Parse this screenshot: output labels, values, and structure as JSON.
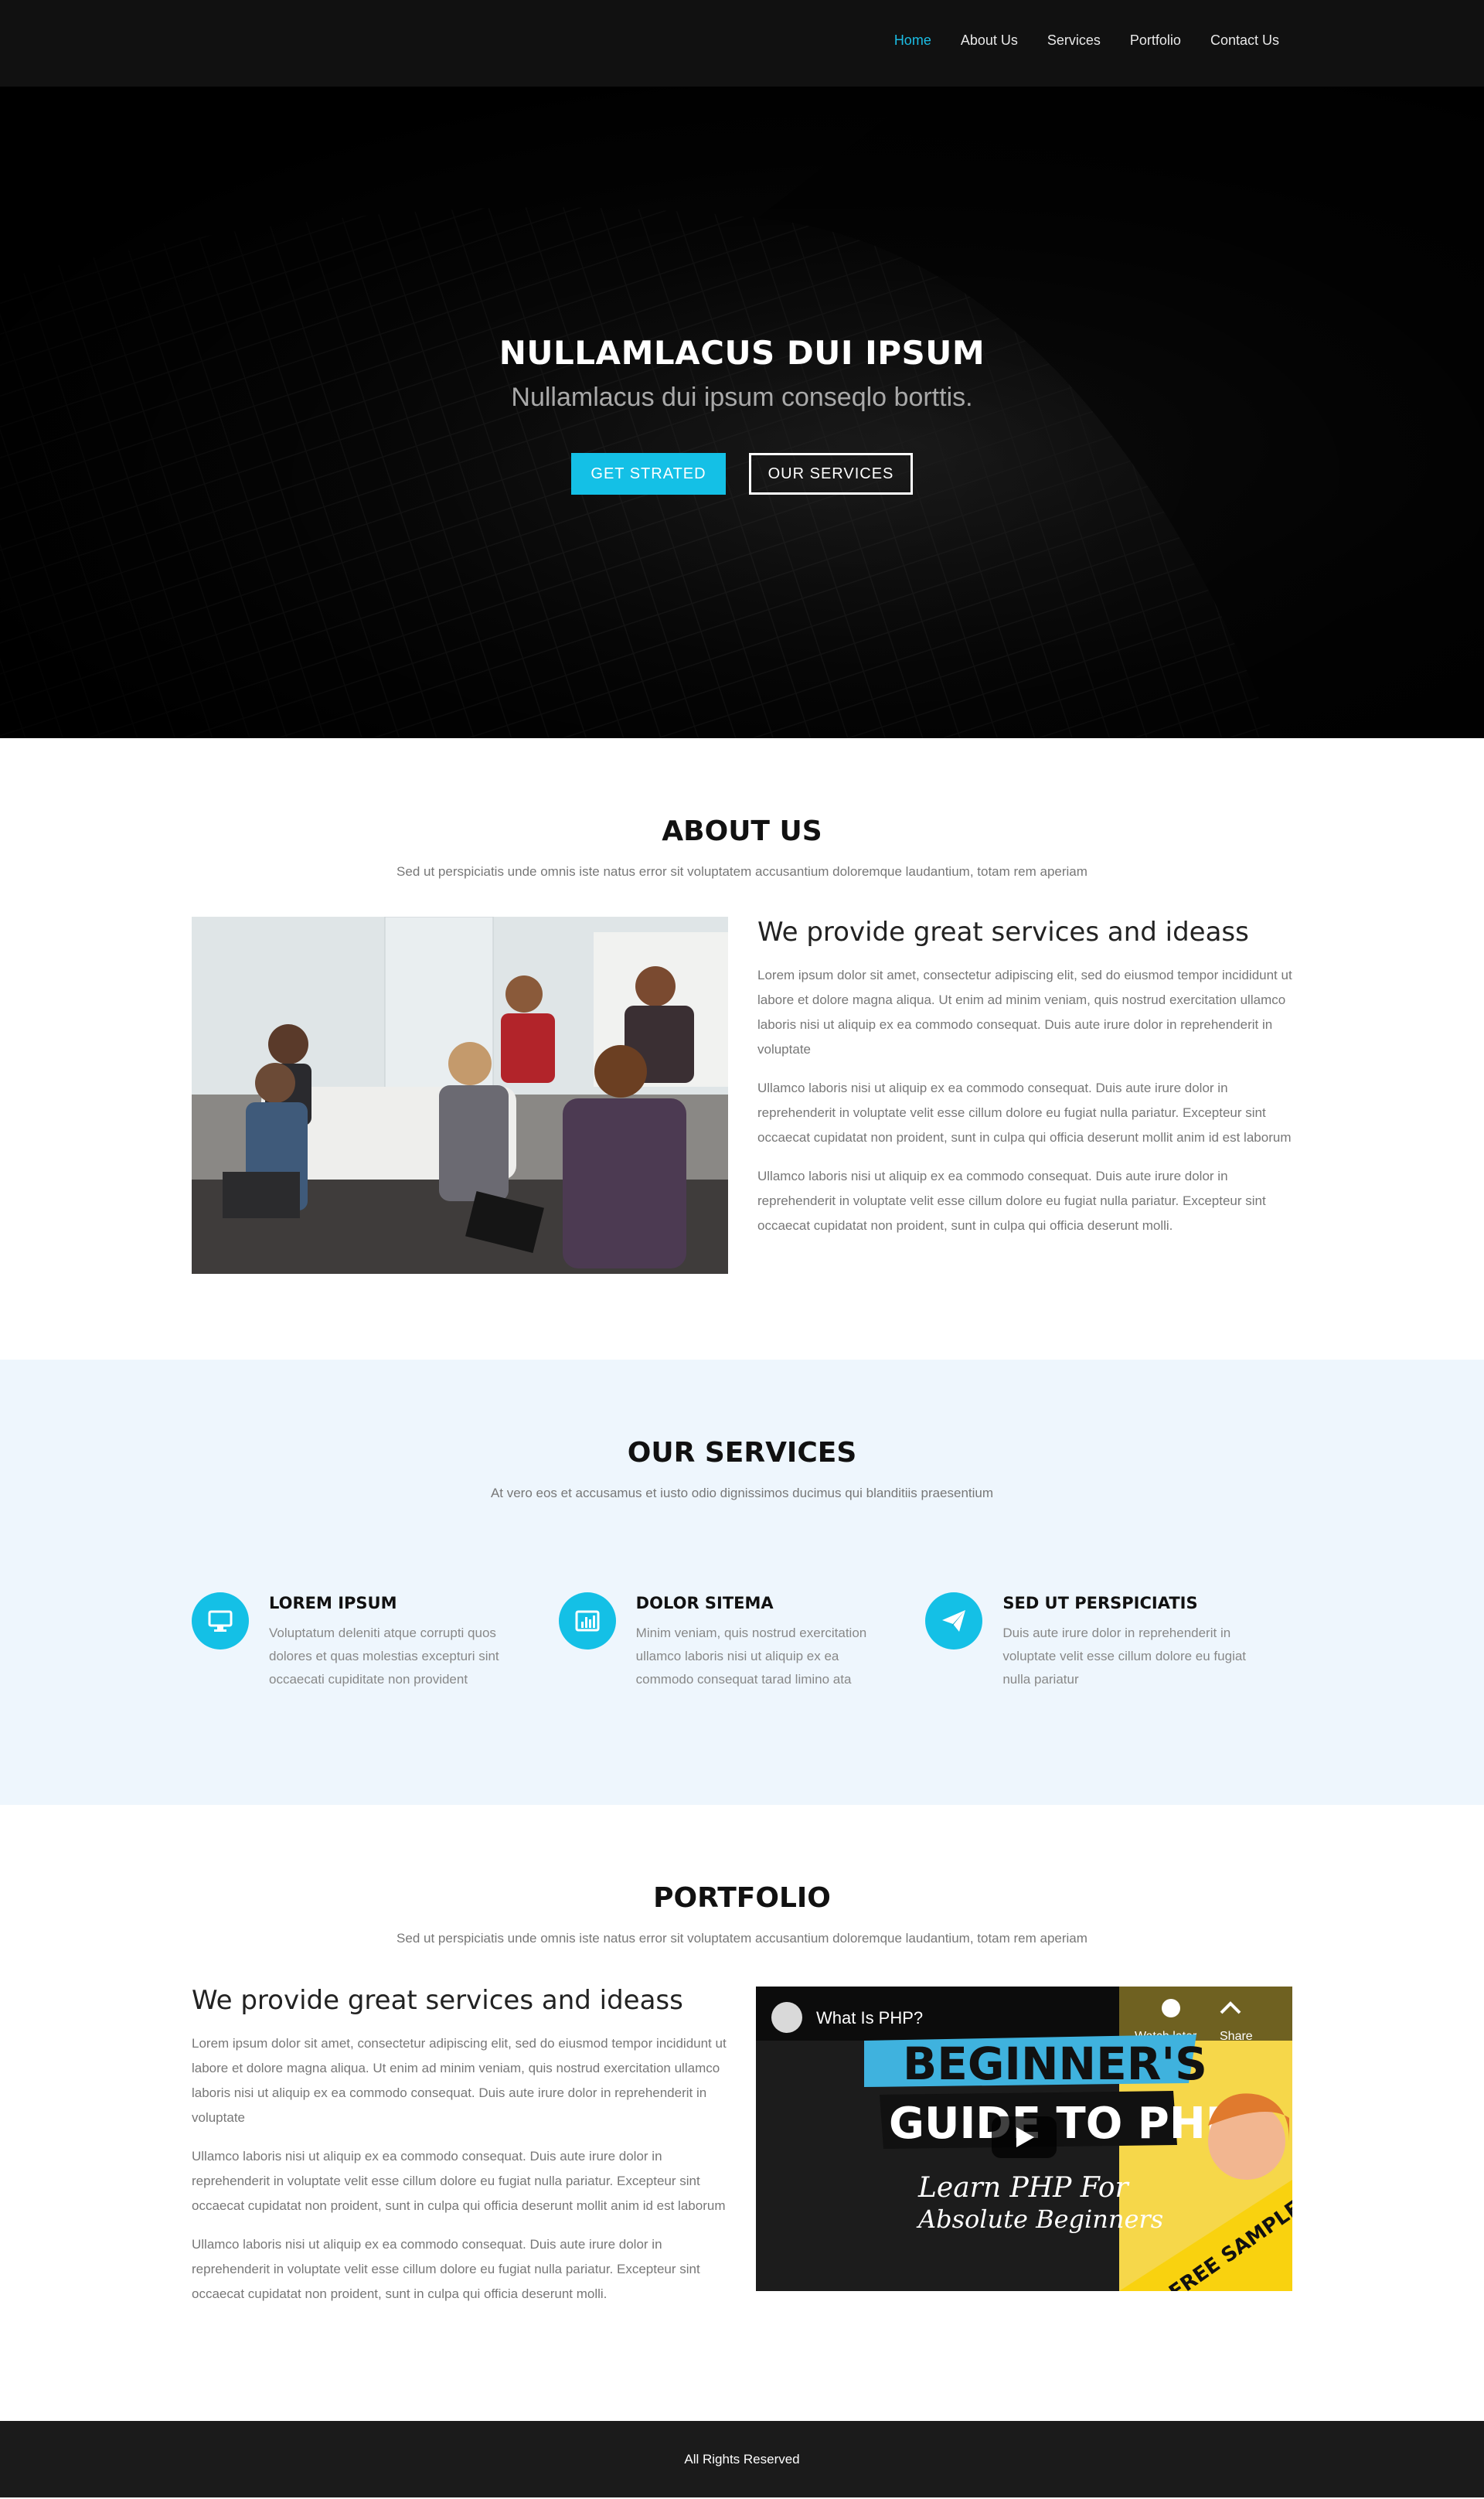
{
  "nav": {
    "items": [
      {
        "label": "Home",
        "active": true
      },
      {
        "label": "About Us"
      },
      {
        "label": "Services"
      },
      {
        "label": "Portfolio"
      },
      {
        "label": "Contact Us"
      }
    ]
  },
  "hero": {
    "title": "NULLAMLACUS DUI IPSUM",
    "subtitle": "Nullamlacus dui ipsum conseqlo borttis.",
    "primary_button": "GET STRATED",
    "secondary_button": "OUR SERVICES"
  },
  "about": {
    "title": "ABOUT US",
    "subtitle": "Sed ut perspiciatis unde omnis iste natus error sit voluptatem accusantium doloremque laudantium, totam rem aperiam",
    "heading": "We provide great services and ideass",
    "paragraphs": [
      "Lorem ipsum dolor sit amet, consectetur adipiscing elit, sed do eiusmod tempor incididunt ut labore et dolore magna aliqua. Ut enim ad minim veniam, quis nostrud exercitation ullamco laboris nisi ut aliquip ex ea commodo consequat. Duis aute irure dolor in reprehenderit in voluptate",
      "Ullamco laboris nisi ut aliquip ex ea commodo consequat. Duis aute irure dolor in reprehenderit in voluptate velit esse cillum dolore eu fugiat nulla pariatur. Excepteur sint occaecat cupidatat non proident, sunt in culpa qui officia deserunt mollit anim id est laborum",
      "Ullamco laboris nisi ut aliquip ex ea commodo consequat. Duis aute irure dolor in reprehenderit in voluptate velit esse cillum dolore eu fugiat nulla pariatur. Excepteur sint occaecat cupidatat non proident, sunt in culpa qui officia deserunt molli."
    ]
  },
  "services": {
    "title": "OUR SERVICES",
    "subtitle": "At vero eos et accusamus et iusto odio dignissimos ducimus qui blanditiis praesentium",
    "items": [
      {
        "icon": "desktop-icon",
        "title": "LOREM IPSUM",
        "text": "Voluptatum deleniti atque corrupti quos dolores et quas molestias excepturi sint occaecati cupiditate non provident"
      },
      {
        "icon": "bar-chart-icon",
        "title": "DOLOR SITEMA",
        "text": "Minim veniam, quis nostrud exercitation ullamco laboris nisi ut aliquip ex ea commodo consequat tarad limino ata"
      },
      {
        "icon": "paper-plane-icon",
        "title": "SED UT PERSPICIATIS",
        "text": "Duis aute irure dolor in reprehenderit in voluptate velit esse cillum dolore eu fugiat nulla pariatur"
      }
    ]
  },
  "portfolio": {
    "title": "PORTFOLIO",
    "subtitle": "Sed ut perspiciatis unde omnis iste natus error sit voluptatem accusantium doloremque laudantium, totam rem aperiam",
    "heading": "We provide great services and ideass",
    "paragraphs": [
      "Lorem ipsum dolor sit amet, consectetur adipiscing elit, sed do eiusmod tempor incididunt ut labore et dolore magna aliqua. Ut enim ad minim veniam, quis nostrud exercitation ullamco laboris nisi ut aliquip ex ea commodo consequat. Duis aute irure dolor in reprehenderit in voluptate",
      "Ullamco laboris nisi ut aliquip ex ea commodo consequat. Duis aute irure dolor in reprehenderit in voluptate velit esse cillum dolore eu fugiat nulla pariatur. Excepteur sint occaecat cupidatat non proident, sunt in culpa qui officia deserunt mollit anim id est laborum",
      "Ullamco laboris nisi ut aliquip ex ea commodo consequat. Duis aute irure dolor in reprehenderit in voluptate velit esse cillum dolore eu fugiat nulla pariatur. Excepteur sint occaecat cupidatat non proident, sunt in culpa qui officia deserunt molli."
    ],
    "video": {
      "title": "What Is PHP?",
      "watch_later": "Watch later",
      "share": "Share",
      "banner_line1": "BEGINNER'S",
      "banner_line2": "GUIDE TO PHP",
      "tagline1": "Learn PHP For",
      "tagline2": "Absolute Beginners",
      "ribbon": "FREE SAMPLE"
    }
  },
  "footer": {
    "text": "All Rights Reserved"
  },
  "colors": {
    "accent": "#14c0e6",
    "nav_bg": "#111111",
    "services_bg": "#eef6fd",
    "footer_bg": "#1b1b1b"
  }
}
